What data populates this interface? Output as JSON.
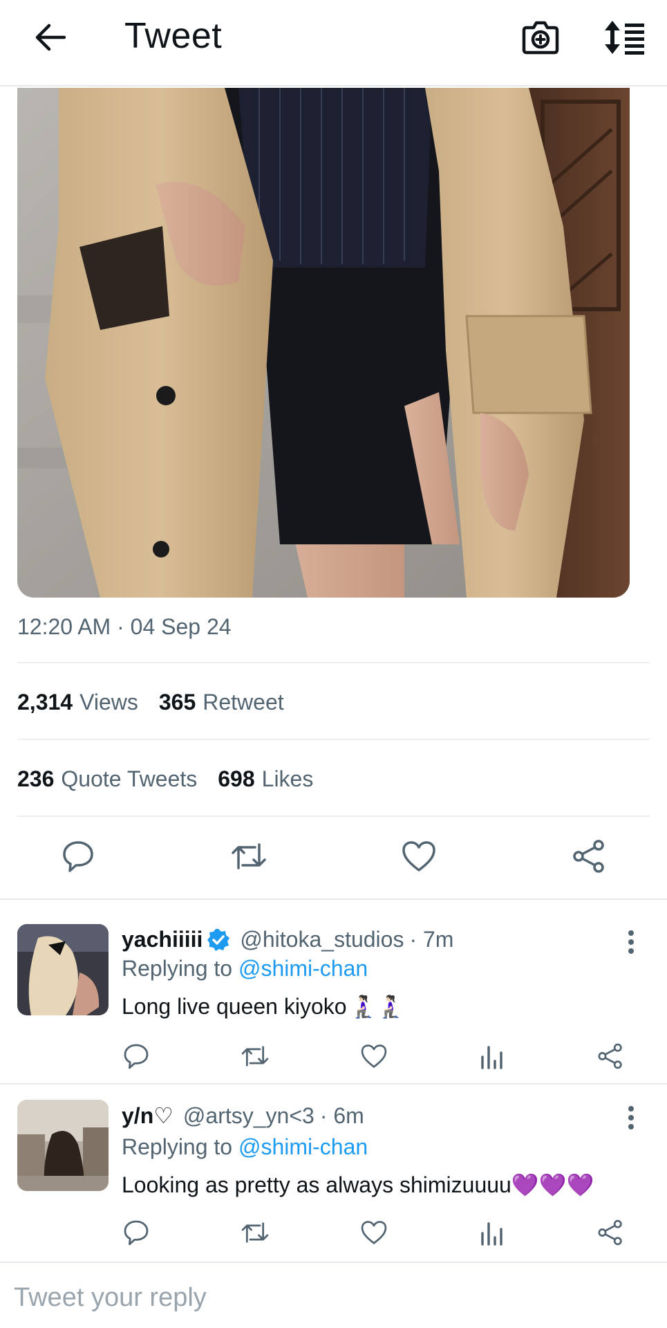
{
  "header": {
    "title": "Tweet",
    "back_icon": "arrow-left-icon",
    "camera_icon": "camera-plus-icon",
    "sort_icon": "sort-list-icon"
  },
  "tweet": {
    "image_alt": "photo",
    "timestamp": "12:20 AM · 04 Sep 24",
    "stats": {
      "views_count": "2,314",
      "views_label": "Views",
      "retweets_count": "365",
      "retweets_label": "Retweet",
      "quotes_count": "236",
      "quotes_label": "Quote Tweets",
      "likes_count": "698",
      "likes_label": "Likes"
    }
  },
  "replies": [
    {
      "name": "yachiiiii",
      "verified": true,
      "handle": "@hitoka_studios",
      "time": "· 7m",
      "replying_prefix": "Replying to",
      "replying_to": "@shimi-chan",
      "text": "Long live queen kiyoko",
      "emoji": "🧎🏻‍♀️🧎🏻‍♀️"
    },
    {
      "name": "y/n♡",
      "verified": false,
      "handle": "@artsy_yn<3",
      "time": "· 6m",
      "replying_prefix": "Replying to",
      "replying_to": "@shimi-chan",
      "text": "Looking as pretty as always shimizuuuu",
      "emoji": "💜💜💜"
    }
  ],
  "composer": {
    "placeholder": "Tweet your reply"
  },
  "colors": {
    "accent": "#1d9bf0",
    "secondary_text": "#536471",
    "primary_text": "#0f1419",
    "divider": "#e6e8eb"
  }
}
